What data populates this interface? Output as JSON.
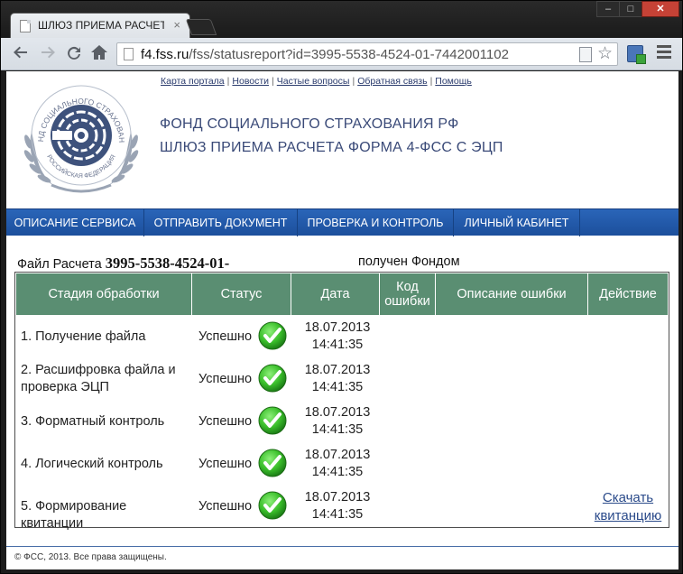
{
  "browser": {
    "tab_title": "ШЛЮЗ ПРИЕМА РАСЧЕТ",
    "tab_close": "×",
    "win_min": "–",
    "win_max": "□",
    "win_close": "✕",
    "url_host": "f4.fss.ru",
    "url_path": "/fss/statusreport?id=3995-5538-4524-01-7442001102"
  },
  "header": {
    "links": [
      "Карта портала",
      "Новости",
      "Частые вопросы",
      "Обратная связь",
      "Помощь"
    ],
    "org_line1": "ФОНД СОЦИАЛЬНОГО СТРАХОВАНИЯ РФ",
    "org_line2": "ШЛЮЗ ПРИЕМА РАСЧЕТА ФОРМА 4-ФСС С ЭЦП",
    "logo_text": "ФОНД СОЦИАЛЬНОГО СТРАХОВАНИЯ РОССИЙСКАЯ ФЕДЕРАЦИЯ"
  },
  "nav": {
    "items": [
      "ОПИСАНИЕ СЕРВИСА",
      "ОТПРАВИТЬ ДОКУМЕНТ",
      "ПРОВЕРКА И КОНТРОЛЬ",
      "ЛИЧНЫЙ КАБИНЕТ"
    ]
  },
  "report": {
    "file_label": "Файл Расчета",
    "file_id": "3995-5538-4524-01-",
    "received_text": "получен Фондом",
    "columns": [
      "Стадия обработки",
      "Статус",
      "Дата",
      "Код ошибки",
      "Описание ошибки",
      "Действие"
    ],
    "rows": [
      {
        "stage": "1. Получение файла",
        "status": "Успешно",
        "date": "18.07.2013",
        "time": "14:41:35",
        "action": ""
      },
      {
        "stage": "2. Расшифровка файла и проверка ЭЦП",
        "status": "Успешно",
        "date": "18.07.2013",
        "time": "14:41:35",
        "action": ""
      },
      {
        "stage": "3. Форматный контроль",
        "status": "Успешно",
        "date": "18.07.2013",
        "time": "14:41:35",
        "action": ""
      },
      {
        "stage": "4. Логический контроль",
        "status": "Успешно",
        "date": "18.07.2013",
        "time": "14:41:35",
        "action": ""
      },
      {
        "stage": "5. Формирование квитанции",
        "status": "Успешно",
        "date": "18.07.2013",
        "time": "14:41:35",
        "action": "Скачать квитанцию"
      }
    ]
  },
  "footer": {
    "text": "© ФСС, 2013. Все права защищены."
  },
  "icons": {
    "status_ok": "green-check-icon"
  },
  "colors": {
    "nav": "#1f57a8",
    "table_header": "#5a8e72",
    "org_text": "#3a4a78"
  }
}
